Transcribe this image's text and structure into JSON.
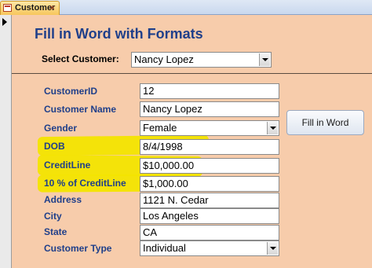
{
  "tab": {
    "label": "Customer",
    "close_glyph": "×"
  },
  "form": {
    "title": "Fill in Word with Formats",
    "select_label": "Select Customer:",
    "select_value": "Nancy Lopez",
    "button_label": "Fill in Word"
  },
  "fields": {
    "customer_id": {
      "label": "CustomerID",
      "value": "12"
    },
    "customer_name": {
      "label": "Customer Name",
      "value": "Nancy Lopez"
    },
    "gender": {
      "label": "Gender",
      "value": "Female"
    },
    "dob": {
      "label": "DOB",
      "value": "8/4/1998"
    },
    "credit_line": {
      "label": "CreditLine",
      "value": "$10,000.00"
    },
    "pct_credit_line": {
      "label": "10 % of CreditLine",
      "value": "$1,000.00"
    },
    "address": {
      "label": "Address",
      "value": "1121 N. Cedar"
    },
    "city": {
      "label": "City",
      "value": "Los Angeles"
    },
    "state": {
      "label": "State",
      "value": "CA"
    },
    "customer_type": {
      "label": "Customer Type",
      "value": "Individual"
    }
  },
  "colors": {
    "background": "#f7ccab",
    "label": "#1f3f8a",
    "highlight": "#f3e400"
  }
}
